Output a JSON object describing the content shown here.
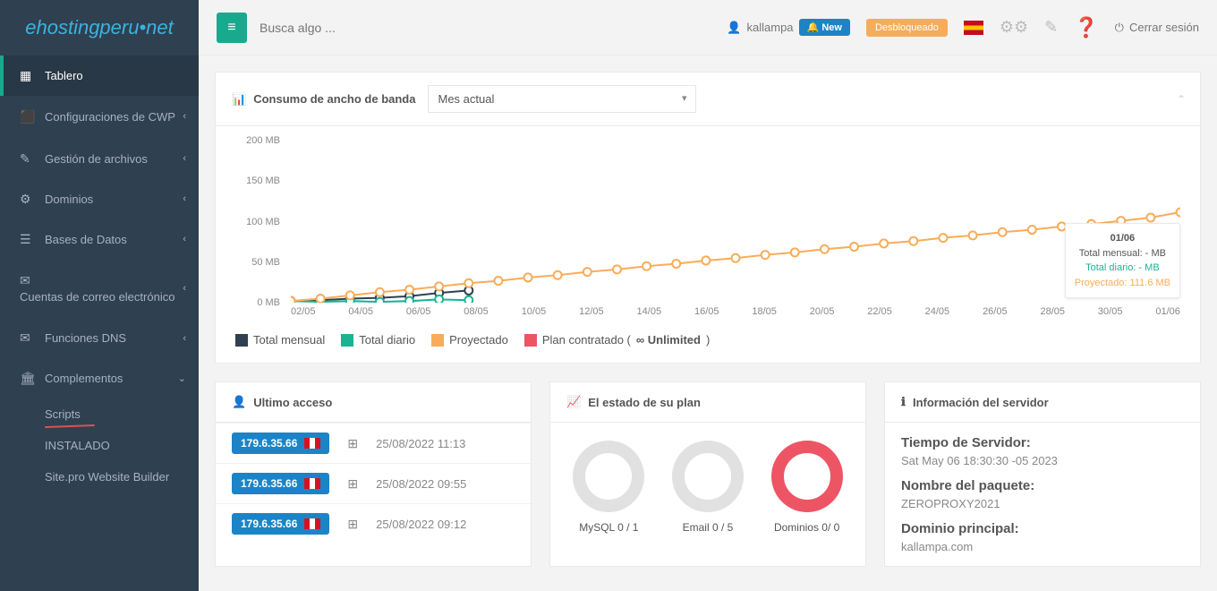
{
  "logo": "ehostingperu•net",
  "search_placeholder": "Busca algo ...",
  "user": {
    "name": "kallampa",
    "new_label": "New",
    "unlock_label": "Desbloqueado",
    "logout_label": "Cerrar sesión"
  },
  "sidebar": {
    "items": [
      {
        "label": "Tablero",
        "icon": "▦",
        "active": true,
        "chev": false
      },
      {
        "label": "Configuraciones de CWP",
        "icon": "📊",
        "chev": true
      },
      {
        "label": "Gestión de archivos",
        "icon": "✎",
        "chev": true
      },
      {
        "label": "Dominios",
        "icon": "⚙",
        "chev": true
      },
      {
        "label": "Bases de Datos",
        "icon": "🗄",
        "chev": true
      },
      {
        "label": "Cuentas de correo electrónico",
        "icon": "✉",
        "chev": true
      },
      {
        "label": "Funciones DNS",
        "icon": "✉",
        "chev": true
      },
      {
        "label": "Complementos",
        "icon": "🏛",
        "chev": true,
        "open": true
      }
    ],
    "sub": [
      {
        "label": "Scripts"
      },
      {
        "label": "INSTALADO"
      },
      {
        "label": "Site.pro Website Builder"
      }
    ]
  },
  "bandwidth_panel": {
    "title": "Consumo de ancho de banda",
    "period_selected": "Mes actual",
    "legend": {
      "total": "Total mensual",
      "daily": "Total diario",
      "proj": "Proyectado",
      "plan_prefix": "Plan contratado (",
      "plan_value": "∞ Unlimited",
      "plan_suffix": ")"
    },
    "tooltip": {
      "date": "01/06",
      "total": "Total mensual: - MB",
      "daily": "Total diario: - MB",
      "proj": "Proyectado: 111.6 MB"
    }
  },
  "chart_data": {
    "type": "line",
    "xlabel": "",
    "ylabel": "",
    "ylim": [
      0,
      200
    ],
    "y_unit": "MB",
    "y_ticks": [
      0,
      50,
      100,
      150,
      200
    ],
    "categories": [
      "02/05",
      "03/05",
      "04/05",
      "05/05",
      "06/05",
      "07/05",
      "08/05",
      "09/05",
      "10/05",
      "11/05",
      "12/05",
      "13/05",
      "14/05",
      "15/05",
      "16/05",
      "17/05",
      "18/05",
      "19/05",
      "20/05",
      "21/05",
      "22/05",
      "23/05",
      "24/05",
      "25/05",
      "26/05",
      "27/05",
      "28/05",
      "29/05",
      "30/05",
      "31/05",
      "01/06"
    ],
    "x_ticks_display": [
      "02/05",
      "04/05",
      "06/05",
      "08/05",
      "10/05",
      "12/05",
      "14/05",
      "16/05",
      "18/05",
      "20/05",
      "22/05",
      "24/05",
      "26/05",
      "28/05",
      "30/05",
      "01/06"
    ],
    "series": [
      {
        "name": "Total mensual",
        "color": "#2f4050",
        "values": [
          2,
          3,
          5,
          6,
          8,
          12,
          15,
          null,
          null,
          null,
          null,
          null,
          null,
          null,
          null,
          null,
          null,
          null,
          null,
          null,
          null,
          null,
          null,
          null,
          null,
          null,
          null,
          null,
          null,
          null,
          null
        ]
      },
      {
        "name": "Total diario",
        "color": "#1ab394",
        "values": [
          2,
          1,
          2,
          1,
          2,
          4,
          3,
          null,
          null,
          null,
          null,
          null,
          null,
          null,
          null,
          null,
          null,
          null,
          null,
          null,
          null,
          null,
          null,
          null,
          null,
          null,
          null,
          null,
          null,
          null,
          null
        ]
      },
      {
        "name": "Proyectado",
        "color": "#f8ac59",
        "values": [
          2,
          5,
          9,
          13,
          16,
          20,
          24,
          27,
          31,
          34,
          38,
          41,
          45,
          48,
          52,
          55,
          59,
          62,
          66,
          69,
          73,
          76,
          80,
          83,
          87,
          90,
          94,
          97,
          101,
          105,
          111.6
        ]
      }
    ]
  },
  "last_access": {
    "title": "Ultimo acceso",
    "rows": [
      {
        "ip": "179.6.35.66",
        "time": "25/08/2022 11:13"
      },
      {
        "ip": "179.6.35.66",
        "time": "25/08/2022 09:55"
      },
      {
        "ip": "179.6.35.66",
        "time": "25/08/2022 09:12"
      }
    ]
  },
  "plan_status": {
    "title": "El estado de su plan",
    "items": [
      {
        "label": "MySQL 0 / 1",
        "filled": false
      },
      {
        "label": "Email 0 / 5",
        "filled": false
      },
      {
        "label": "Dominios 0/ 0",
        "filled": true
      }
    ]
  },
  "server_info": {
    "title": "Información del servidor",
    "items": [
      {
        "label": "Tiempo de Servidor:",
        "value": "Sat May 06 18:30:30 -05 2023"
      },
      {
        "label": "Nombre del paquete:",
        "value": "ZEROPROXY2021"
      },
      {
        "label": "Dominio principal:",
        "value": "kallampa.com"
      }
    ]
  }
}
